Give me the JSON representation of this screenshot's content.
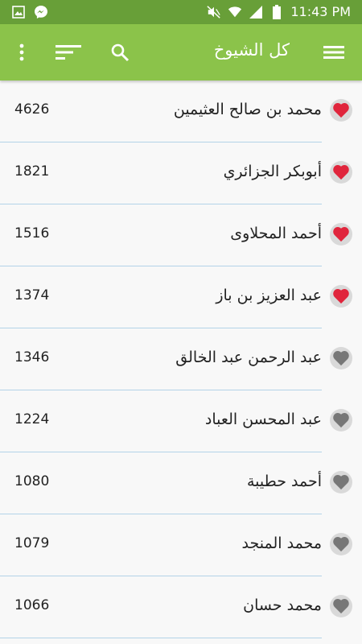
{
  "status_bar": {
    "time": "11:43 PM",
    "icons": [
      "gallery-icon",
      "messenger-icon",
      "mute-icon",
      "wifi-icon",
      "signal-icon",
      "battery-icon"
    ]
  },
  "app_bar": {
    "title": "كل الشيوخ",
    "icons": [
      "menu-icon",
      "search-icon",
      "sort-icon",
      "more-vert-icon"
    ],
    "color": "#8bc34a"
  },
  "list": [
    {
      "name": "محمد بن صالح العثيمين",
      "count": "4626",
      "favorite": true
    },
    {
      "name": "أبوبكر الجزائري",
      "count": "1821",
      "favorite": true
    },
    {
      "name": "أحمد المحلاوى",
      "count": "1516",
      "favorite": true
    },
    {
      "name": "عبد العزيز بن باز",
      "count": "1374",
      "favorite": true
    },
    {
      "name": "عبد الرحمن عبد الخالق",
      "count": "1346",
      "favorite": false
    },
    {
      "name": "عبد المحسن العباد",
      "count": "1224",
      "favorite": false
    },
    {
      "name": "أحمد حطيبة",
      "count": "1080",
      "favorite": false
    },
    {
      "name": "محمد المنجد",
      "count": "1079",
      "favorite": false
    },
    {
      "name": "محمد حسان",
      "count": "1066",
      "favorite": false
    }
  ],
  "colors": {
    "favorite": "#e0253c",
    "not_favorite": "#777777",
    "divider": "#b3d3e8"
  }
}
